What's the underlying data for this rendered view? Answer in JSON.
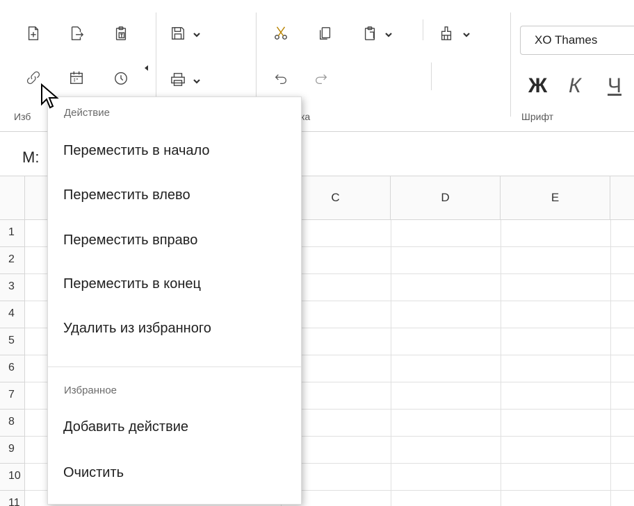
{
  "ribbon": {
    "groups": [
      {
        "label": "Изб"
      },
      {
        "label": "ка"
      },
      {
        "label": "Шрифт"
      }
    ],
    "font_name": "XO Thames",
    "format_letters": {
      "bold": "Ж",
      "italic": "К",
      "underline": "Ч"
    },
    "icons": [
      "new-document-icon",
      "export-icon",
      "paste-special-icon",
      "save-icon",
      "print-icon",
      "link-icon",
      "calendar-icon",
      "clock-icon",
      "cut-icon",
      "copy-icon",
      "paste-icon",
      "format-painter-icon",
      "undo-icon",
      "redo-icon"
    ]
  },
  "namebox": {
    "value": "M:"
  },
  "grid": {
    "columns": [
      "C",
      "D",
      "E"
    ],
    "rows": [
      "1",
      "2",
      "3",
      "4",
      "5",
      "6",
      "7",
      "8",
      "9",
      "10",
      "11"
    ]
  },
  "menu": {
    "section1_title": "Действие",
    "section1_items": [
      "Переместить в начало",
      "Переместить влево",
      "Переместить вправо",
      "Переместить в конец",
      "Удалить из избранного"
    ],
    "section2_title": "Избранное",
    "section2_items": [
      "Добавить действие",
      "Очистить"
    ]
  }
}
